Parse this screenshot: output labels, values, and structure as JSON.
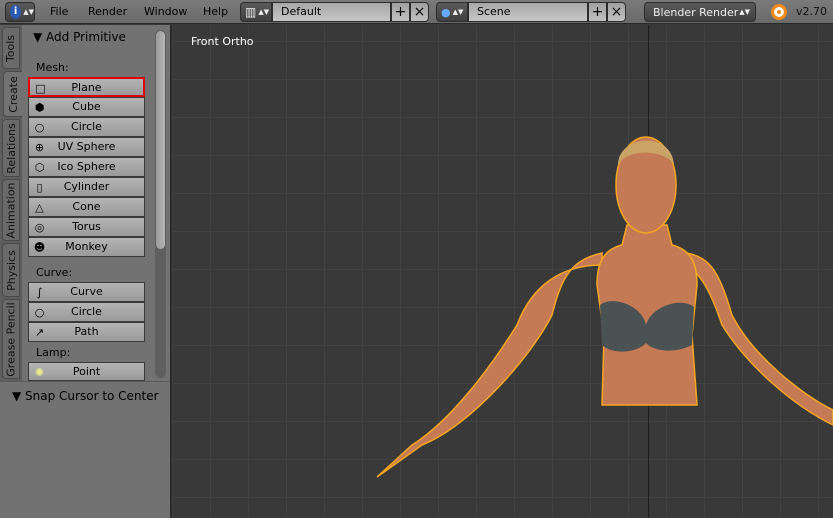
{
  "header": {
    "menus": [
      "File",
      "Render",
      "Window",
      "Help"
    ],
    "screen_layout": "Default",
    "scene": "Scene",
    "render_engine": "Blender Render",
    "version": "v2.70"
  },
  "tabs": [
    "Tools",
    "Create",
    "Relations",
    "Animation",
    "Physics",
    "Grease Pencil"
  ],
  "active_tab": "Create",
  "panel": {
    "title": "Add Primitive",
    "mesh_label": "Mesh:",
    "mesh": [
      "Plane",
      "Cube",
      "Circle",
      "UV Sphere",
      "Ico Sphere",
      "Cylinder",
      "Cone",
      "Torus",
      "Monkey"
    ],
    "curve_label": "Curve:",
    "curve": [
      "Curve",
      "Circle",
      "Path"
    ],
    "lamp_label": "Lamp:",
    "lamp": [
      "Point"
    ],
    "highlighted": "Plane"
  },
  "snap_panel": {
    "title": "Snap Cursor to Center"
  },
  "viewport": {
    "label": "Front Ortho"
  },
  "colors": {
    "highlight": "#e00000",
    "outline": "#f5a623",
    "viewport_bg": "#393939"
  }
}
